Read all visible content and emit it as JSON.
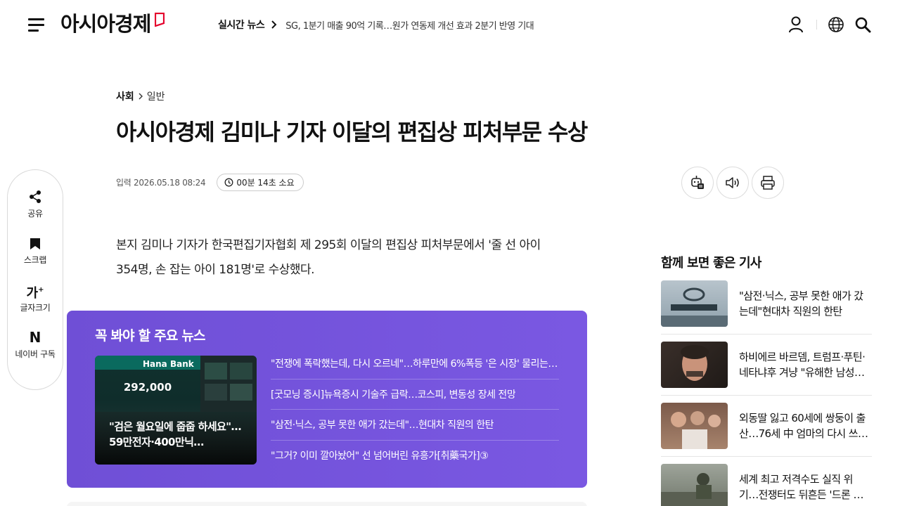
{
  "header": {
    "logo_text": "아시아경제",
    "ticker_label": "실시간 뉴스",
    "ticker_text": "SG, 1분기 매출 90억 기록…원가 연동제 개선 효과 2분기 반영 기대",
    "brand_color": "#e4002b"
  },
  "article": {
    "section": "사회",
    "subsection": "일반",
    "headline": "아시아경제 김미나 기자 이달의 편집상 피처부문 수상",
    "date": "입력 2026.05.18 08:24",
    "read_time": "00분 14초 소요",
    "body": "본지 김미나 기자가 한국편집기자협회 제 295회 이달의 편집상 피처부문에서 '줄 선 아이 354명, 손 잡는 아이 181명'로 수상했다."
  },
  "sidebar": {
    "items": [
      {
        "label": "공유",
        "icon": "share-icon"
      },
      {
        "label": "스크랩",
        "icon": "bookmark-icon"
      },
      {
        "label": "글자크기",
        "icon": "font-size-icon",
        "glyph": "가",
        "sup": "+"
      },
      {
        "label": "네이버 구독",
        "icon": "naver-icon",
        "glyph": "N"
      }
    ]
  },
  "tools": [
    "ai-summary-icon",
    "speaker-icon",
    "print-icon"
  ],
  "feature": {
    "title": "꼭 봐야 할 주요 뉴스",
    "thumb": {
      "bank": "Hana Bank",
      "number": "292,000",
      "caption": "\"검은 월요일에 줍줍 하세요\"…59만전자·400만닉…"
    },
    "items": [
      "\"전쟁에 폭락했는데, 다시 오르네\"…하루만에 6%폭등 '은 시장' 물리는 …",
      "[굿모닝 증시]뉴욕증시 기술주 급락…코스피, 변동성 장세 전망",
      "\"삼전·닉스, 공부 못한 애가 갔는데\"…현대차 직원의 한탄",
      "\"그거? 이미 깔아놨어\" 선 넘어버린 유흥가[취藥국가]③"
    ],
    "bg_color": "#7555dd"
  },
  "related": {
    "title": "함께 보면 좋은 기사",
    "items": [
      "\"삼전·닉스, 공부 못한 애가 갔는데\"현대차 직원의 한탄",
      "하비에르 바르뎀, 트럼프·푸틴·네타냐후 겨냥 \"유해한 남성성…",
      "외동딸 잃고 60세에 쌍둥이 출산…76세 中 엄마의 다시 쓰…",
      "세계 최고 저격수도 실직 위기…전쟁터도 뒤흔든 '드론 전성시대'"
    ]
  }
}
